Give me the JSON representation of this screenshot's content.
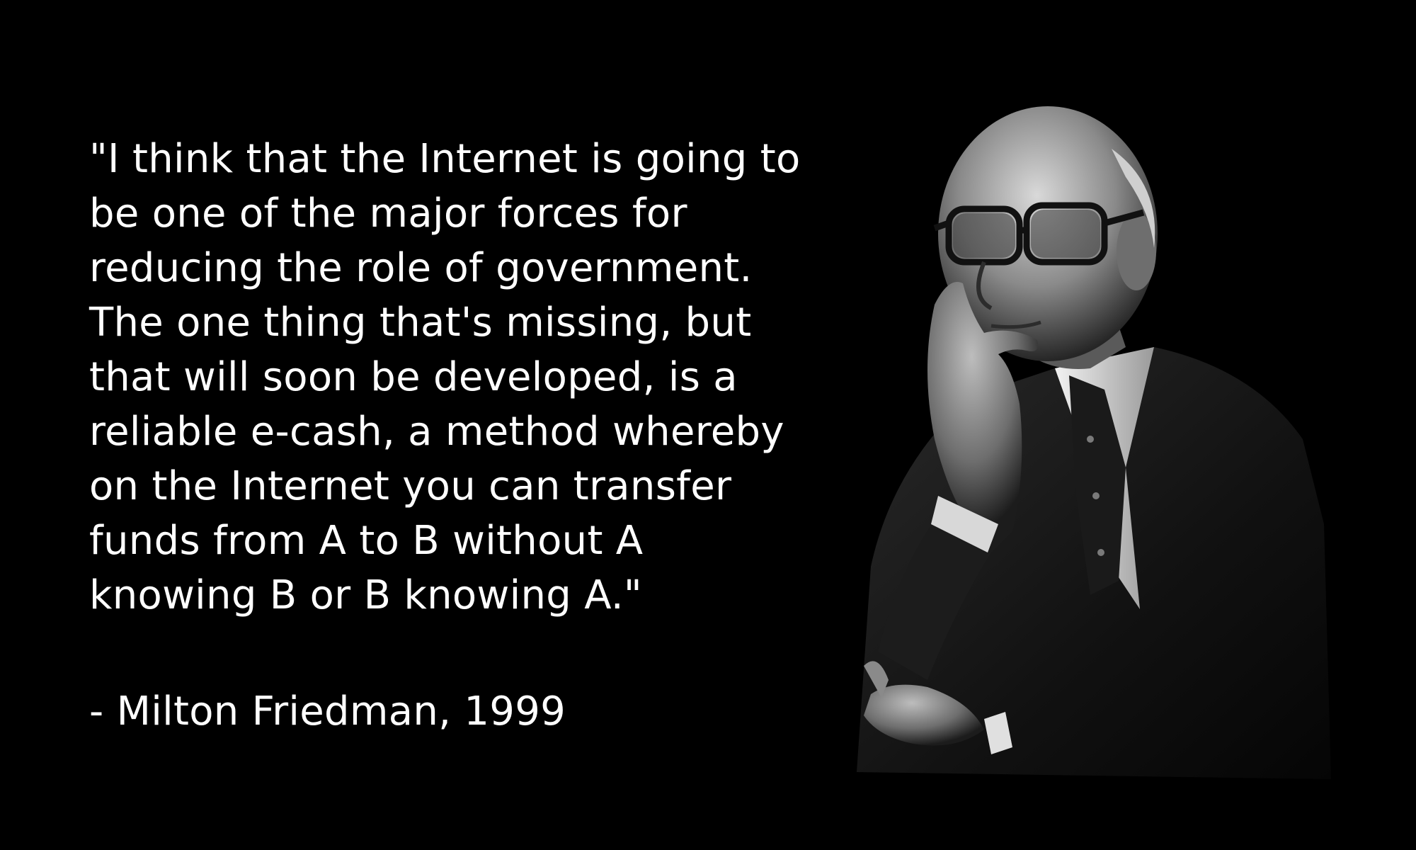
{
  "quote": {
    "lines": [
      "\"I think that the Internet is going to",
      "be one of the major forces for",
      "reducing the role of government.",
      "The one thing that's missing, but",
      "that will soon be developed, is a",
      "reliable e-cash, a method whereby",
      "on the Internet you can transfer",
      "funds from A to B without A",
      "knowing B or B knowing A.\""
    ],
    "attribution": "- Milton Friedman, 1999"
  },
  "colors": {
    "background": "#000000",
    "text": "#ffffff"
  },
  "portrait": {
    "icon": "elderly-man-portrait-icon",
    "style": "black-and-white photograph"
  }
}
